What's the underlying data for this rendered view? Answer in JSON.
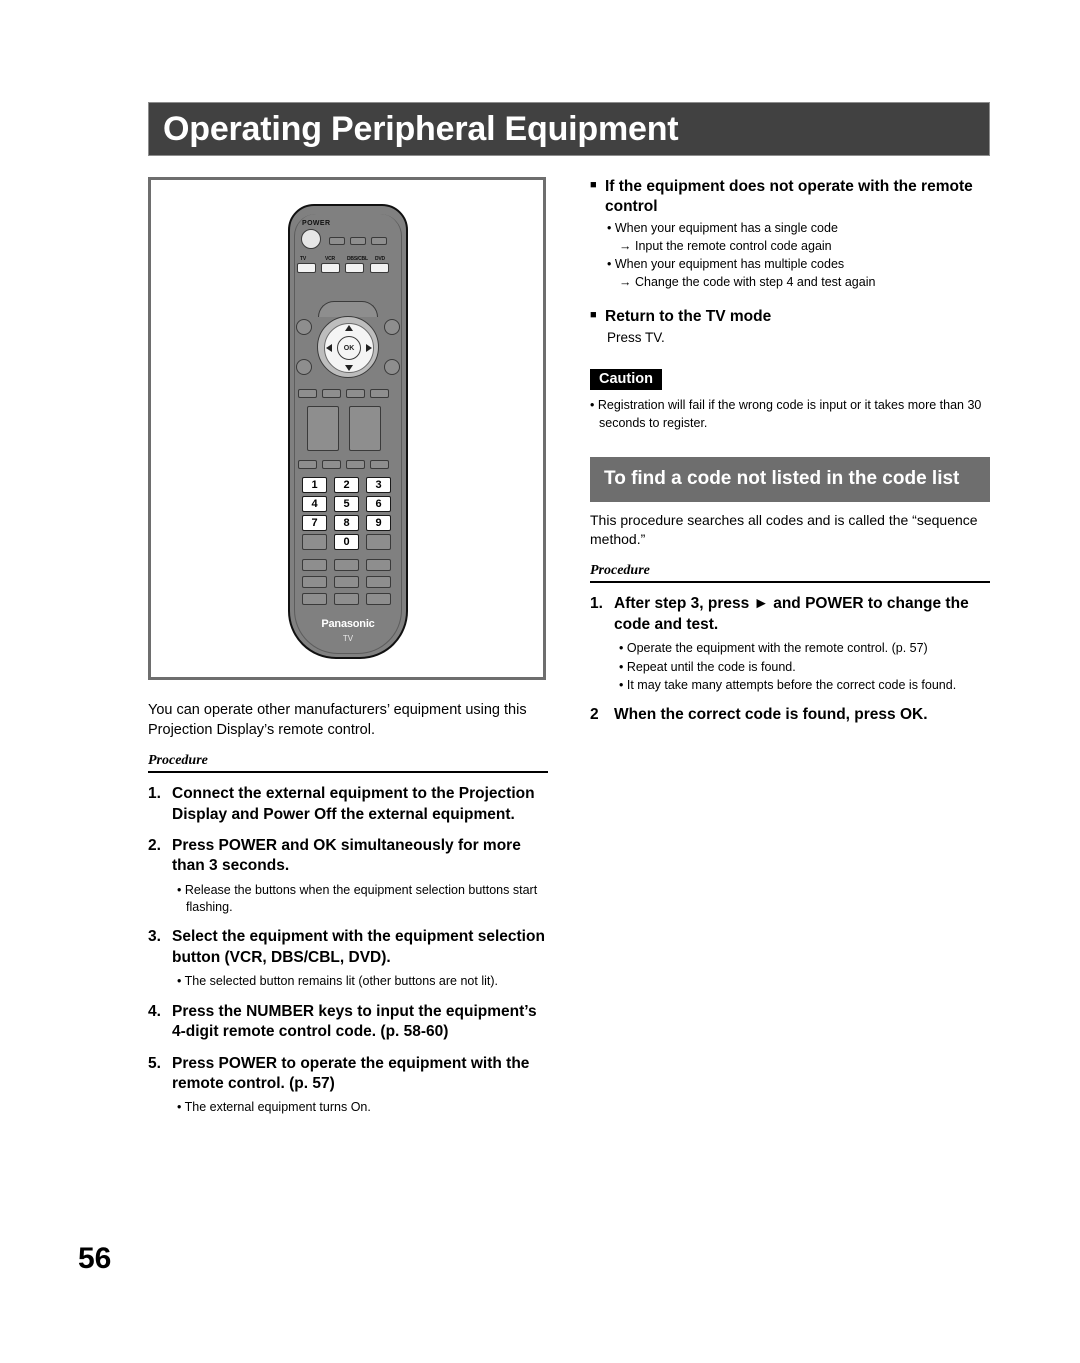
{
  "header": {
    "title": "Operating Peripheral Equipment"
  },
  "page_number": "56",
  "figure": {
    "remote": {
      "power_label": "POWER",
      "source_labels": [
        "TV",
        "VCR",
        "DBS/CBL",
        "DVD"
      ],
      "ok_label": "OK",
      "number_keys": [
        "1",
        "2",
        "3",
        "4",
        "5",
        "6",
        "7",
        "8",
        "9",
        "0"
      ],
      "brand": "Panasonic",
      "mode_label": "TV"
    }
  },
  "left": {
    "intro": "You can operate other manufacturers’ equipment using this Projection Display’s remote control.",
    "procedure_label": "Procedure",
    "steps": [
      {
        "number": "1.",
        "text": "Connect the external equipment to the Projection Display and Power Off the external equipment.",
        "bullets": []
      },
      {
        "number": "2.",
        "text": "Press POWER and OK simultaneously for more than 3 seconds.",
        "bullets": [
          "Release the buttons when the equipment selection buttons start flashing."
        ]
      },
      {
        "number": "3.",
        "text": "Select the equipment with the equipment selection button (VCR, DBS/CBL, DVD).",
        "bullets": [
          "The selected button remains lit (other buttons are not lit)."
        ]
      },
      {
        "number": "4.",
        "text": "Press the NUMBER keys to input the equipment’s 4-digit remote control code. (p. 58-60)",
        "bullets": []
      },
      {
        "number": "5.",
        "text": "Press POWER to operate the equipment with the remote control. (p. 57)",
        "bullets": [
          "The external equipment turns On."
        ]
      }
    ]
  },
  "right": {
    "section1": {
      "heading": "If the equipment does not operate with the remote control",
      "items": [
        {
          "bullet": "When your equipment has a single code",
          "arrow": "→ Input the remote control code again"
        },
        {
          "bullet": "When your equipment has multiple codes",
          "arrow": "→ Change the code with step 4 and test again"
        }
      ]
    },
    "section2": {
      "heading": "Return to the TV mode",
      "text": "Press TV."
    },
    "caution": {
      "label": "Caution",
      "text": "Registration will fail if the wrong code is input or it takes more than 30 seconds to register."
    },
    "section3": {
      "heading": "To find a code not listed in the code list",
      "intro": "This procedure searches all codes and is called the “sequence method.”",
      "procedure_label": "Procedure",
      "steps": [
        {
          "number": "1.",
          "text": "After step 3, press ► and POWER to change the code and test.",
          "bullets": [
            "Operate the equipment with the remote control. (p. 57)",
            "Repeat until the code is found.",
            "It may take many attempts before the correct code is found."
          ]
        },
        {
          "number": "2",
          "text": "When the correct code is found, press OK.",
          "bullets": []
        }
      ]
    }
  },
  "colors": {
    "title_bar": "#414141",
    "gray_heading": "#6e6e6e",
    "caution_tag": "#000000"
  }
}
